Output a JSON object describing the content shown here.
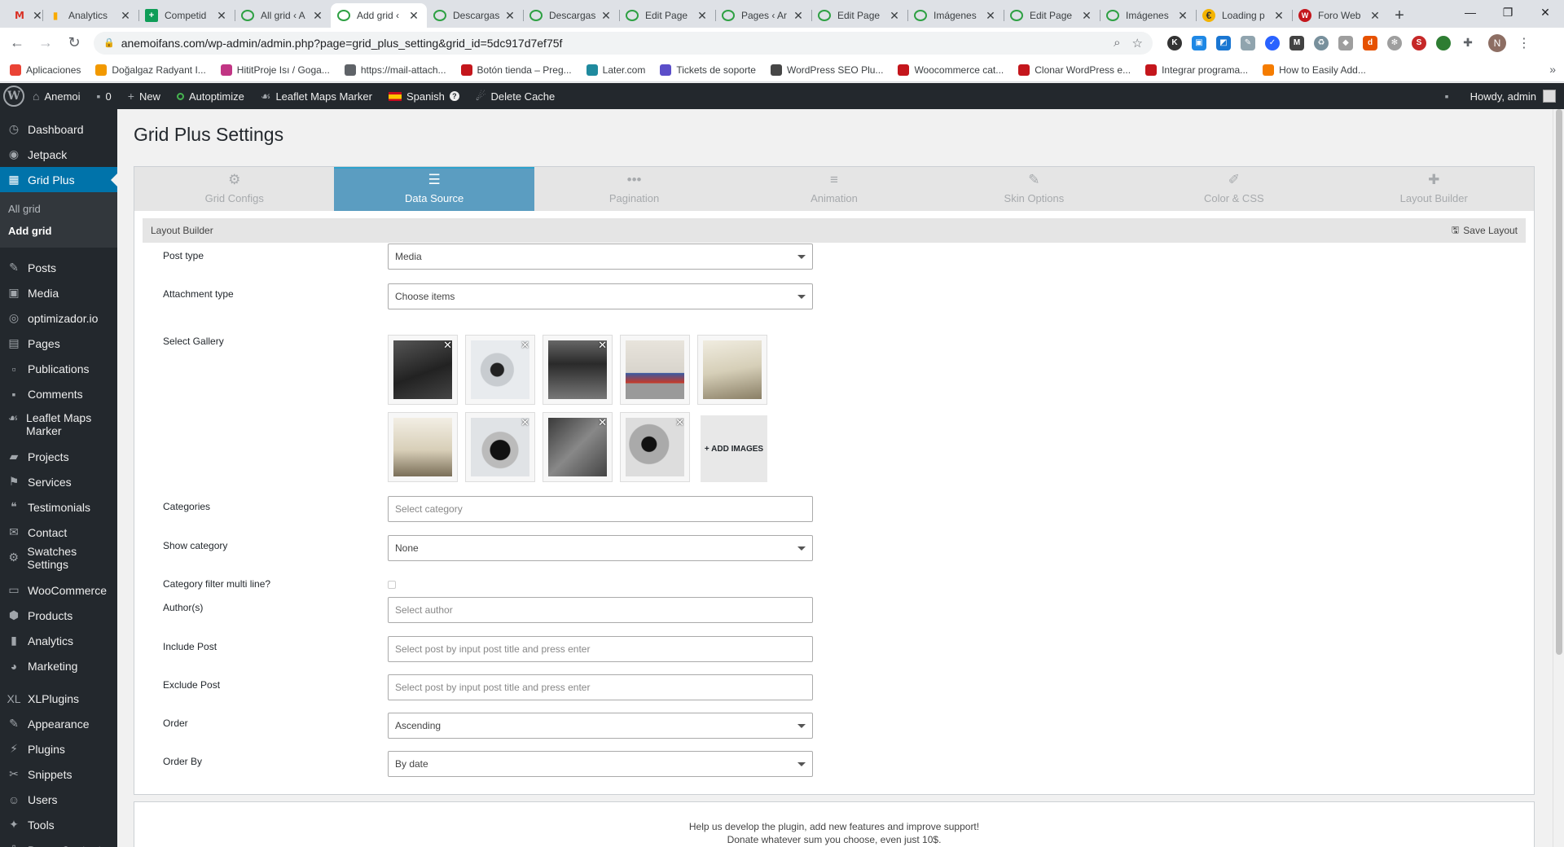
{
  "browser": {
    "tabs": [
      {
        "title": "",
        "favicon": "gmail-icon",
        "fav_text": "M"
      },
      {
        "title": "Analytics",
        "favicon": "analytics-icon",
        "fav_text": "▮"
      },
      {
        "title": "Competid",
        "favicon": "sheets-icon",
        "fav_text": "+"
      },
      {
        "title": "All grid ‹ A",
        "favicon": "wpengine-icon",
        "fav_text": ""
      },
      {
        "title": "Add grid ‹",
        "favicon": "wpengine-icon",
        "fav_text": "",
        "active": true
      },
      {
        "title": "Descargas",
        "favicon": "wpengine-icon",
        "fav_text": ""
      },
      {
        "title": "Descargas",
        "favicon": "wpengine-icon",
        "fav_text": ""
      },
      {
        "title": "Edit Page",
        "favicon": "wpengine-icon",
        "fav_text": ""
      },
      {
        "title": "Pages ‹ Ar",
        "favicon": "wpengine-icon",
        "fav_text": ""
      },
      {
        "title": "Edit Page",
        "favicon": "wpengine-icon",
        "fav_text": ""
      },
      {
        "title": "Imágenes",
        "favicon": "wpengine-icon",
        "fav_text": ""
      },
      {
        "title": "Edit Page",
        "favicon": "wpengine-icon",
        "fav_text": ""
      },
      {
        "title": "Imágenes",
        "favicon": "wpengine-icon",
        "fav_text": ""
      },
      {
        "title": "Loading p",
        "favicon": "loading-icon",
        "fav_text": "€"
      },
      {
        "title": "Foro Web",
        "favicon": "foro-icon",
        "fav_text": "W"
      }
    ],
    "close_glyph": "✕",
    "new_tab": "+",
    "url": "anemoifans.com/wp-admin/admin.php?page=grid_plus_setting&grid_id=5dc917d7ef75f",
    "profile_initial": "N",
    "bookmarks": [
      {
        "label": "Aplicaciones",
        "icon": "apps-icon",
        "color": "#ea4335"
      },
      {
        "label": "Doğalgaz Radyant I...",
        "icon": "flame-icon",
        "color": "#f29900"
      },
      {
        "label": "HititProje Isı / Goga...",
        "icon": "instagram-icon",
        "color": "#c13584"
      },
      {
        "label": "https://mail-attach...",
        "icon": "globe-icon",
        "color": "#5f6368"
      },
      {
        "label": "Botón tienda – Preg...",
        "icon": "w-icon",
        "color": "#c4161c"
      },
      {
        "label": "Later.com",
        "icon": "later-icon",
        "color": "#1f8a9e"
      },
      {
        "label": "Tickets de soporte",
        "icon": "ticket-icon",
        "color": "#5b4ec9"
      },
      {
        "label": "WordPress SEO Plu...",
        "icon": "wordpress-icon",
        "color": "#464646"
      },
      {
        "label": "Woocommerce cat...",
        "icon": "w-icon",
        "color": "#c4161c"
      },
      {
        "label": "Clonar WordPress e...",
        "icon": "w-icon",
        "color": "#c4161c"
      },
      {
        "label": "Integrar programa...",
        "icon": "w-icon",
        "color": "#c4161c"
      },
      {
        "label": "How to Easily Add...",
        "icon": "orange-icon",
        "color": "#f57c00"
      }
    ]
  },
  "adminbar": {
    "site": "Anemoi",
    "comments": "0",
    "new": "New",
    "autoptimize": "Autoptimize",
    "leaflet": "Leaflet Maps Marker",
    "language": "Spanish",
    "cache": "Delete Cache",
    "howdy": "Howdy, admin"
  },
  "sidebar": {
    "items": [
      {
        "label": "Dashboard",
        "icon": "dashboard-icon"
      },
      {
        "label": "Jetpack",
        "icon": "jetpack-icon"
      },
      {
        "label": "Grid Plus",
        "icon": "grid-icon",
        "current": true
      }
    ],
    "submenu": [
      {
        "label": "All grid"
      },
      {
        "label": "Add grid",
        "current": true
      }
    ],
    "items2": [
      {
        "label": "Posts",
        "icon": "pin-icon"
      },
      {
        "label": "Media",
        "icon": "media-icon"
      },
      {
        "label": "optimizador.io",
        "icon": "optimizer-icon"
      },
      {
        "label": "Pages",
        "icon": "pages-icon"
      },
      {
        "label": "Publications",
        "icon": "publications-icon"
      },
      {
        "label": "Comments",
        "icon": "comments-icon"
      },
      {
        "label": "Leaflet Maps Marker",
        "icon": "leaflet-icon",
        "two": true
      },
      {
        "label": "Projects",
        "icon": "projects-icon"
      },
      {
        "label": "Services",
        "icon": "services-icon"
      },
      {
        "label": "Testimonials",
        "icon": "testimonials-icon"
      },
      {
        "label": "Contact",
        "icon": "mail-icon"
      },
      {
        "label": "Swatches Settings",
        "icon": "gear-icon"
      }
    ],
    "items3": [
      {
        "label": "WooCommerce",
        "icon": "woo-icon"
      },
      {
        "label": "Products",
        "icon": "products-icon"
      },
      {
        "label": "Analytics",
        "icon": "analytics-bars-icon"
      },
      {
        "label": "Marketing",
        "icon": "marketing-icon"
      }
    ],
    "items4": [
      {
        "label": "XLPlugins",
        "icon": "xl-icon"
      },
      {
        "label": "Appearance",
        "icon": "brush-icon"
      },
      {
        "label": "Plugins",
        "icon": "plugin-icon"
      },
      {
        "label": "Snippets",
        "icon": "snippets-icon"
      },
      {
        "label": "Users",
        "icon": "users-icon"
      },
      {
        "label": "Tools",
        "icon": "tools-icon"
      },
      {
        "label": "Demo Content",
        "icon": "demo-icon"
      }
    ]
  },
  "page": {
    "title": "Grid Plus Settings",
    "tabs": [
      {
        "label": "Grid Configs",
        "icon": "cogs-icon",
        "glyph": "⚙"
      },
      {
        "label": "Data Source",
        "icon": "database-icon",
        "glyph": "☰",
        "active": true
      },
      {
        "label": "Pagination",
        "icon": "ellipsis-icon",
        "glyph": "•••"
      },
      {
        "label": "Animation",
        "icon": "sliders-icon",
        "glyph": "≡"
      },
      {
        "label": "Skin Options",
        "icon": "brush-icon",
        "glyph": "✎"
      },
      {
        "label": "Color & CSS",
        "icon": "eyedropper-icon",
        "glyph": "✐"
      },
      {
        "label": "Layout Builder",
        "icon": "puzzle-icon",
        "glyph": "✚"
      }
    ],
    "section": "Layout Builder",
    "save_layout": "Save Layout",
    "fields": {
      "post_type": {
        "label": "Post type",
        "value": "Media"
      },
      "attachment_type": {
        "label": "Attachment type",
        "value": "Choose items"
      },
      "select_gallery": {
        "label": "Select Gallery",
        "add_images": "+ ADD IMAGES"
      },
      "categories": {
        "label": "Categories",
        "placeholder": "Select category"
      },
      "show_category": {
        "label": "Show category",
        "value": "None"
      },
      "cat_multi": {
        "label": "Category filter multi line?"
      },
      "authors": {
        "label": "Author(s)",
        "placeholder": "Select author"
      },
      "include_post": {
        "label": "Include Post",
        "placeholder": "Select post by input post title and press enter"
      },
      "exclude_post": {
        "label": "Exclude Post",
        "placeholder": "Select post by input post title and press enter"
      },
      "order": {
        "label": "Order",
        "value": "Ascending"
      },
      "order_by": {
        "label": "Order By",
        "value": "By date"
      }
    },
    "remove_glyph": "✕",
    "donate_line1": "Help us develop the plugin, add new features and improve support!",
    "donate_line2": "Donate whatever sum you choose, even just 10$."
  }
}
